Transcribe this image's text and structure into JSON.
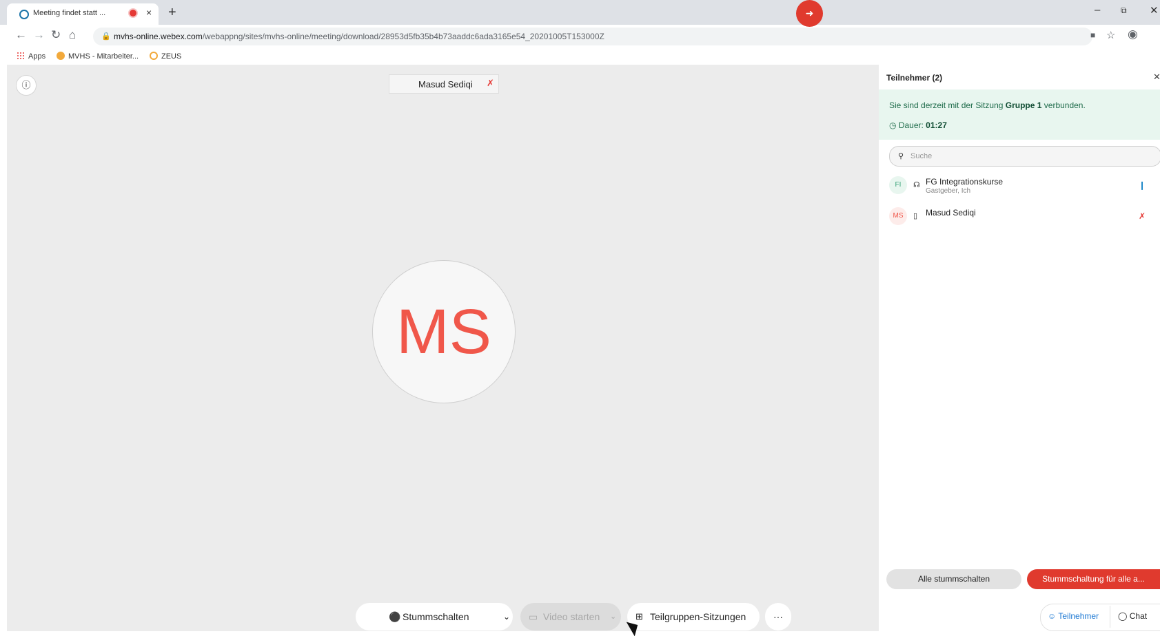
{
  "browser": {
    "tab_title": "Meeting findet statt ...",
    "tab_close": "×",
    "new_tab": "+",
    "url_host": "mvhs-online.webex.com",
    "url_path": "/webappng/sites/mvhs-online/meeting/download/28953d5fb35b4b73aaddc6ada3165e54_20201005T153000Z",
    "bookmarks": [
      "Apps",
      "MVHS - Mitarbeiter...",
      "ZEUS"
    ]
  },
  "stage": {
    "name_chip": "Masud Sediqi",
    "avatar_initials": "MS"
  },
  "controls": {
    "mute_label": "Stummschalten",
    "video_label": "Video starten",
    "breakout_label": "Teilgruppen-Sitzungen",
    "more_label": "···"
  },
  "panel": {
    "title": "Teilnehmer (2)",
    "session_prefix": "Sie sind derzeit mit der Sitzung ",
    "session_name": "Gruppe 1",
    "session_suffix": " verbunden.",
    "duration_label": "Dauer: ",
    "duration_value": "01:27",
    "search_placeholder": "Suche",
    "participants": [
      {
        "initials": "FI",
        "name": "FG Integrationskurse",
        "role": "Gastgeber, Ich"
      },
      {
        "initials": "MS",
        "name": "Masud Sediqi",
        "role": ""
      }
    ],
    "mute_all": "Alle stummschalten",
    "unmute_all": "Stummschaltung für alle a...",
    "tab_participants": "Teilnehmer",
    "tab_chat": "Chat"
  },
  "colors": {
    "accent_red": "#e03a2e",
    "avatar_text": "#f0574a",
    "session_bg": "#e8f6ef",
    "link_blue": "#1976d2"
  }
}
